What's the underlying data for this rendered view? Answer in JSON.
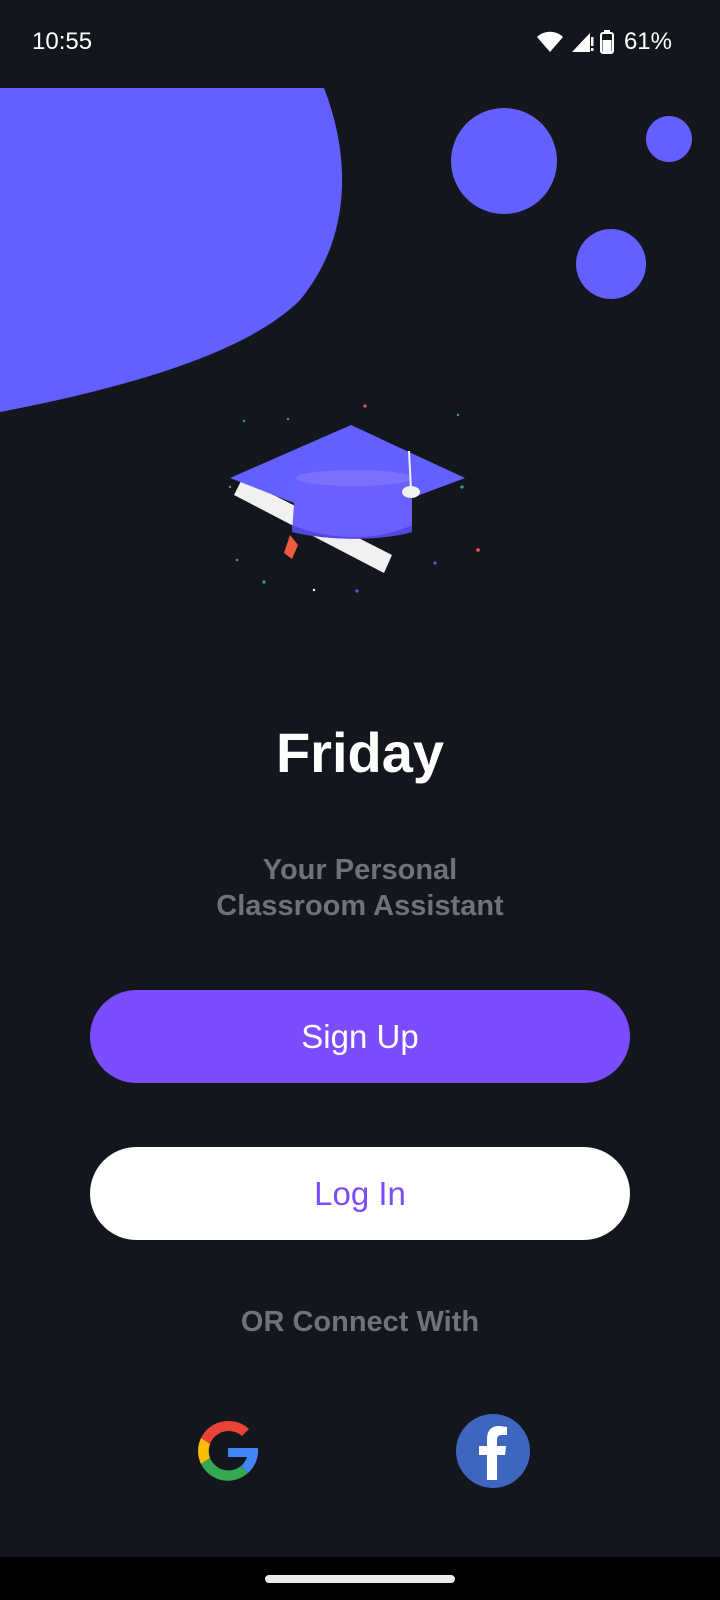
{
  "status_bar": {
    "time": "10:55",
    "battery": "61%",
    "icons": [
      "wifi-icon",
      "cell-signal-icon",
      "battery-icon"
    ]
  },
  "app": {
    "title": "Friday",
    "tagline_line1": "Your Personal",
    "tagline_line2": "Classroom Assistant"
  },
  "actions": {
    "signup_label": "Sign Up",
    "login_label": "Log In",
    "connect_label": "OR Connect With"
  },
  "social": {
    "google_icon": "google-icon",
    "facebook_icon": "facebook-icon"
  },
  "colors": {
    "background": "#13161d",
    "accent_blob": "#6360ff",
    "primary_button": "#7c4dff",
    "secondary_button": "#ffffff",
    "muted_text": "#6f7378"
  }
}
